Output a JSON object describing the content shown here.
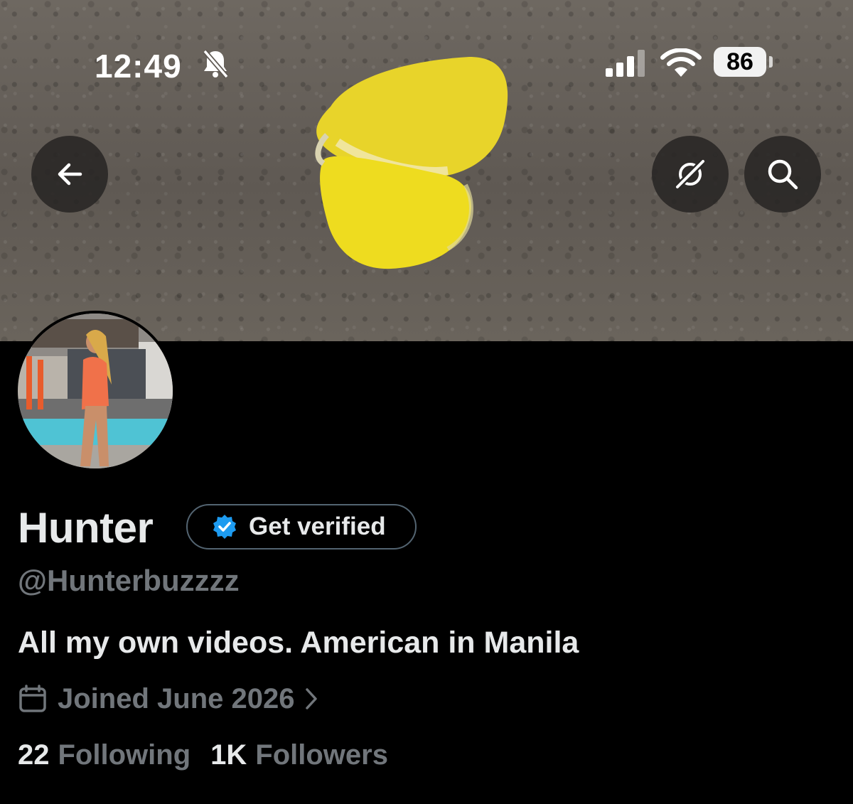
{
  "status_bar": {
    "time": "12:49",
    "battery": "86",
    "icons": [
      "bell-slash-icon",
      "cellular-signal-icon",
      "wifi-icon",
      "battery-icon"
    ]
  },
  "header": {
    "icons": [
      "back-arrow-icon",
      "grok-icon",
      "search-icon"
    ]
  },
  "profile": {
    "name": "Hunter",
    "verify_label": "Get verified",
    "handle": "@Hunterbuzzzz",
    "bio": "All my own videos. American in Manila",
    "joined": "Joined June 2026",
    "following_count": "22",
    "following_label": "Following",
    "followers_count": "1K",
    "followers_label": "Followers"
  },
  "colors": {
    "background": "#000000",
    "primary_text": "#e7e9ea",
    "secondary_text": "#71767b",
    "verified_blue": "#1d9bf0",
    "border": "#536471"
  }
}
